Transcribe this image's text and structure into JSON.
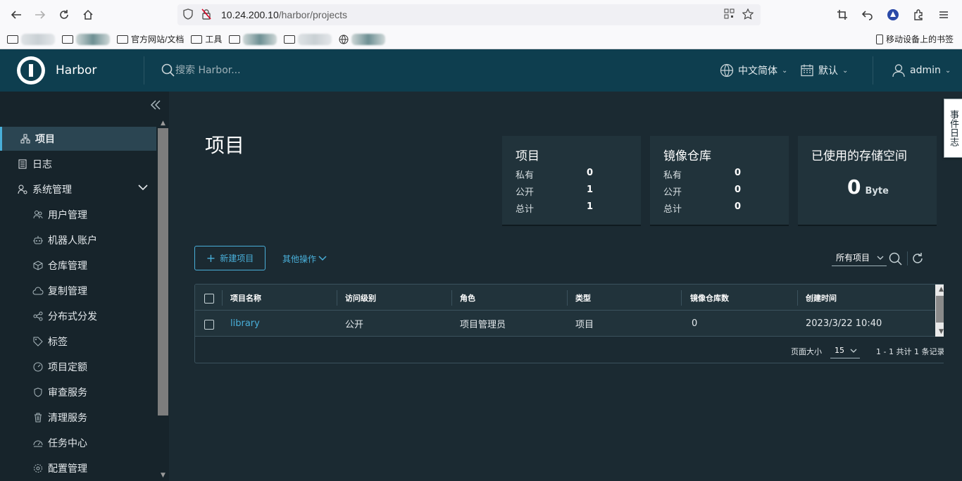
{
  "browser": {
    "url_host": "10.24.200.10",
    "url_path": "/harbor/projects",
    "bookmarks": [
      "官方网站/文档",
      "工具"
    ],
    "mobile_bookmarks": "移动设备上的书签"
  },
  "header": {
    "brand": "Harbor",
    "search_placeholder": "搜索 Harbor...",
    "language": "中文简体",
    "date_format": "默认",
    "user": "admin"
  },
  "sidebar": {
    "items": [
      {
        "label": "项目",
        "icon": "projects-icon",
        "active": true
      },
      {
        "label": "日志",
        "icon": "log-icon"
      },
      {
        "label": "系统管理",
        "icon": "admin-icon",
        "expanded": true
      }
    ],
    "sub_items": [
      {
        "label": "用户管理",
        "icon": "users-icon"
      },
      {
        "label": "机器人账户",
        "icon": "robot-icon"
      },
      {
        "label": "仓库管理",
        "icon": "registry-icon"
      },
      {
        "label": "复制管理",
        "icon": "cloud-replication-icon"
      },
      {
        "label": "分布式分发",
        "icon": "share-icon"
      },
      {
        "label": "标签",
        "icon": "tag-icon"
      },
      {
        "label": "项目定额",
        "icon": "quota-gauge-icon"
      },
      {
        "label": "审查服务",
        "icon": "shield-icon"
      },
      {
        "label": "清理服务",
        "icon": "trash-icon"
      },
      {
        "label": "任务中心",
        "icon": "dashboard-icon"
      },
      {
        "label": "配置管理",
        "icon": "gear-icon"
      }
    ]
  },
  "main": {
    "title": "项目",
    "cards": [
      {
        "title": "项目",
        "rows": [
          {
            "label": "私有",
            "value": "0"
          },
          {
            "label": "公开",
            "value": "1"
          },
          {
            "label": "总计",
            "value": "1"
          }
        ]
      },
      {
        "title": "镜像仓库",
        "rows": [
          {
            "label": "私有",
            "value": "0"
          },
          {
            "label": "公开",
            "value": "0"
          },
          {
            "label": "总计",
            "value": "0"
          }
        ]
      }
    ],
    "storage": {
      "title": "已使用的存储空间",
      "value": "0",
      "unit": "Byte"
    },
    "new_project_label": "新建项目",
    "other_actions_label": "其他操作",
    "filter_label": "所有项目",
    "table": {
      "columns": [
        "项目名称",
        "访问级别",
        "角色",
        "类型",
        "镜像仓库数",
        "创建时间"
      ],
      "rows": [
        {
          "name": "library",
          "access": "公开",
          "role": "项目管理员",
          "type": "项目",
          "repo_count": "0",
          "created": "2023/3/22 10:40"
        }
      ]
    },
    "page_size_label": "页面大小",
    "page_size": "15",
    "pagination_info": "1 - 1 共计 1 条记录"
  },
  "event_log_label": "事件日志",
  "colors": {
    "accent": "#49afd9",
    "header_bg": "#0e3e4f",
    "sidebar_bg": "#17242b",
    "main_bg": "#1b2a32"
  }
}
